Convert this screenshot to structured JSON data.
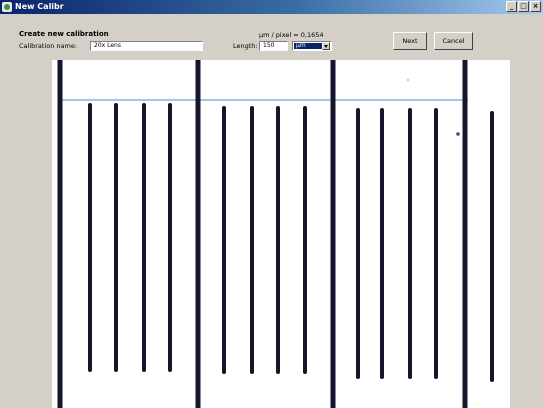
{
  "window": {
    "title": "New Calibr",
    "buttons": [
      "_",
      "□",
      "×"
    ]
  },
  "form": {
    "section_title": "Create new calibration",
    "calibration_name_label": "Calibration name:",
    "calibration_name_value": "20x Lens",
    "length_label": "Length:",
    "length_value": "150",
    "scale_readout": "µm / pixel = 0,1654",
    "unit_selected": "µm",
    "next_label": "Next",
    "cancel_label": "Cancel"
  },
  "image": {
    "subject": "stage micrometer calibration slide",
    "colors": {
      "line": "#15152e",
      "guide": "#4a8ad8",
      "background": "#ffffff"
    }
  }
}
